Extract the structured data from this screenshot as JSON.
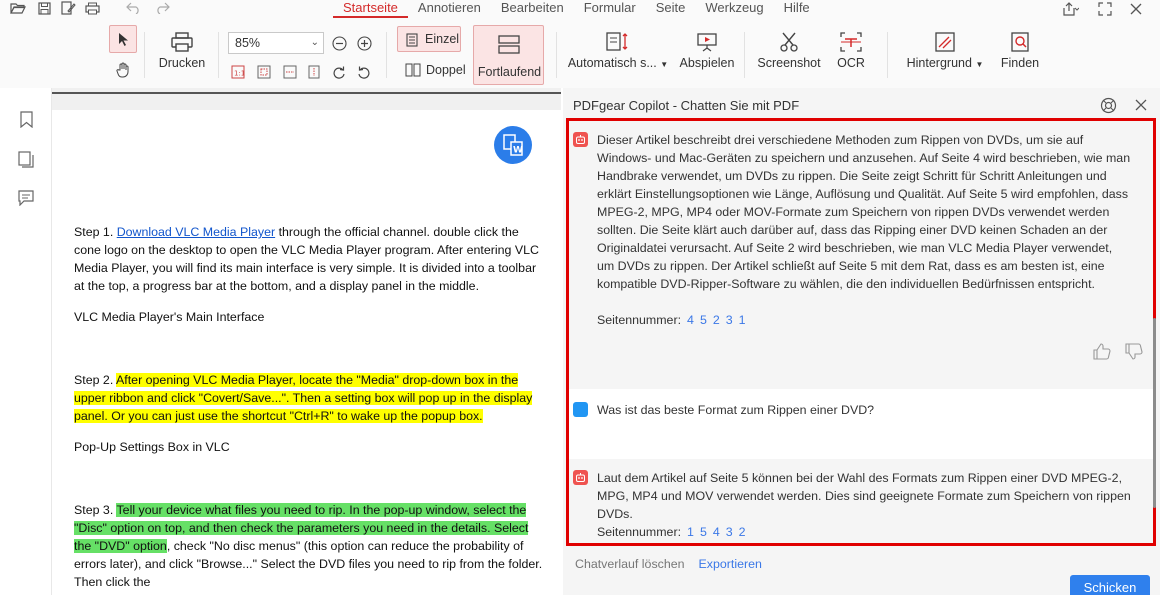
{
  "menu": {
    "tabs": [
      "Startseite",
      "Annotieren",
      "Bearbeiten",
      "Formular",
      "Seite",
      "Werkzeug",
      "Hilfe"
    ],
    "active_tab": "Startseite"
  },
  "toolbar": {
    "print_label": "Drucken",
    "zoom_value": "85%",
    "single_label": "Einzel",
    "double_label": "Doppel",
    "continuous_label": "Fortlaufend",
    "auto_label": "Automatisch s...",
    "play_label": "Abspielen",
    "screenshot_label": "Screenshot",
    "ocr_label": "OCR",
    "background_label": "Hintergrund",
    "find_label": "Finden"
  },
  "document": {
    "step1_prefix": "Step 1. ",
    "step1_link": "Download VLC Media Player",
    "step1_rest": " through the official channel. double click the cone logo on the desktop to open the VLC Media Player program. After entering VLC Media Player, you will find its main interface is very simple. It is divided into a toolbar at the top, a progress bar at the bottom, and a display panel in the middle.",
    "caption1": "VLC Media Player's Main Interface",
    "step2_prefix": "Step 2. ",
    "step2_highlight": "After opening VLC Media Player, locate the \"Media\" drop-down box in the upper ribbon and click \"Covert/Save...\". Then a setting box will pop up in the display panel. Or you can just use the shortcut \"Ctrl+R\" to wake up the popup box.",
    "caption2": "Pop-Up Settings Box in VLC",
    "step3_prefix": "Step 3. ",
    "step3_highlight": "Tell your device what files you need to rip. In the pop-up window, select the \"Disc\" option on top, and then check the parameters you need in the details. Select the \"DVD\" option",
    "step3_rest": ", check \"No disc menus\" (this option can reduce the probability of errors later), and click \"Browse...\" Select the DVD files you need to rip from the folder. Then click the"
  },
  "copilot": {
    "title": "PDFgear Copilot - Chatten Sie mit PDF",
    "messages": [
      {
        "role": "ai",
        "text": "Dieser Artikel beschreibt drei verschiedene Methoden zum Rippen von DVDs, um sie auf Windows- und Mac-Geräten zu speichern und anzusehen. Auf Seite 4 wird beschrieben, wie man Handbrake verwendet, um DVDs zu rippen. Die Seite zeigt Schritt für Schritt Anleitungen und erklärt Einstellungsoptionen wie Länge, Auflösung und Qualität. Auf Seite 5 wird empfohlen, dass MPEG-2, MPG, MP4 oder MOV-Formate zum Speichern von rippen DVDs verwendet werden sollten. Die Seite klärt auch darüber auf, dass das Ripping einer DVD keinen Schaden an der Originaldatei verursacht. Auf Seite 2 wird beschrieben, wie man VLC Media Player verwendet, um DVDs zu rippen. Der Artikel schließt auf Seite 5 mit dem Rat, dass es am besten ist, eine kompatible DVD-Ripper-Software zu wählen, die den individuellen Bedürfnissen entspricht.",
        "pages_label": "Seitennummer:",
        "pages": [
          "4",
          "5",
          "2",
          "3",
          "1"
        ]
      },
      {
        "role": "user",
        "text": "Was ist das beste Format zum Rippen einer DVD?"
      },
      {
        "role": "ai",
        "text": "Laut dem Artikel auf Seite 5 können bei der Wahl des Formats zum Rippen einer DVD MPEG-2, MPG, MP4 und MOV verwendet werden. Dies sind geeignete Formate zum Speichern von rippen DVDs.",
        "pages_label": "Seitennummer:",
        "pages": [
          "1",
          "5",
          "4",
          "3",
          "2"
        ]
      }
    ],
    "clear_label": "Chatverlauf löschen",
    "export_label": "Exportieren",
    "send_label": "Schicken"
  }
}
